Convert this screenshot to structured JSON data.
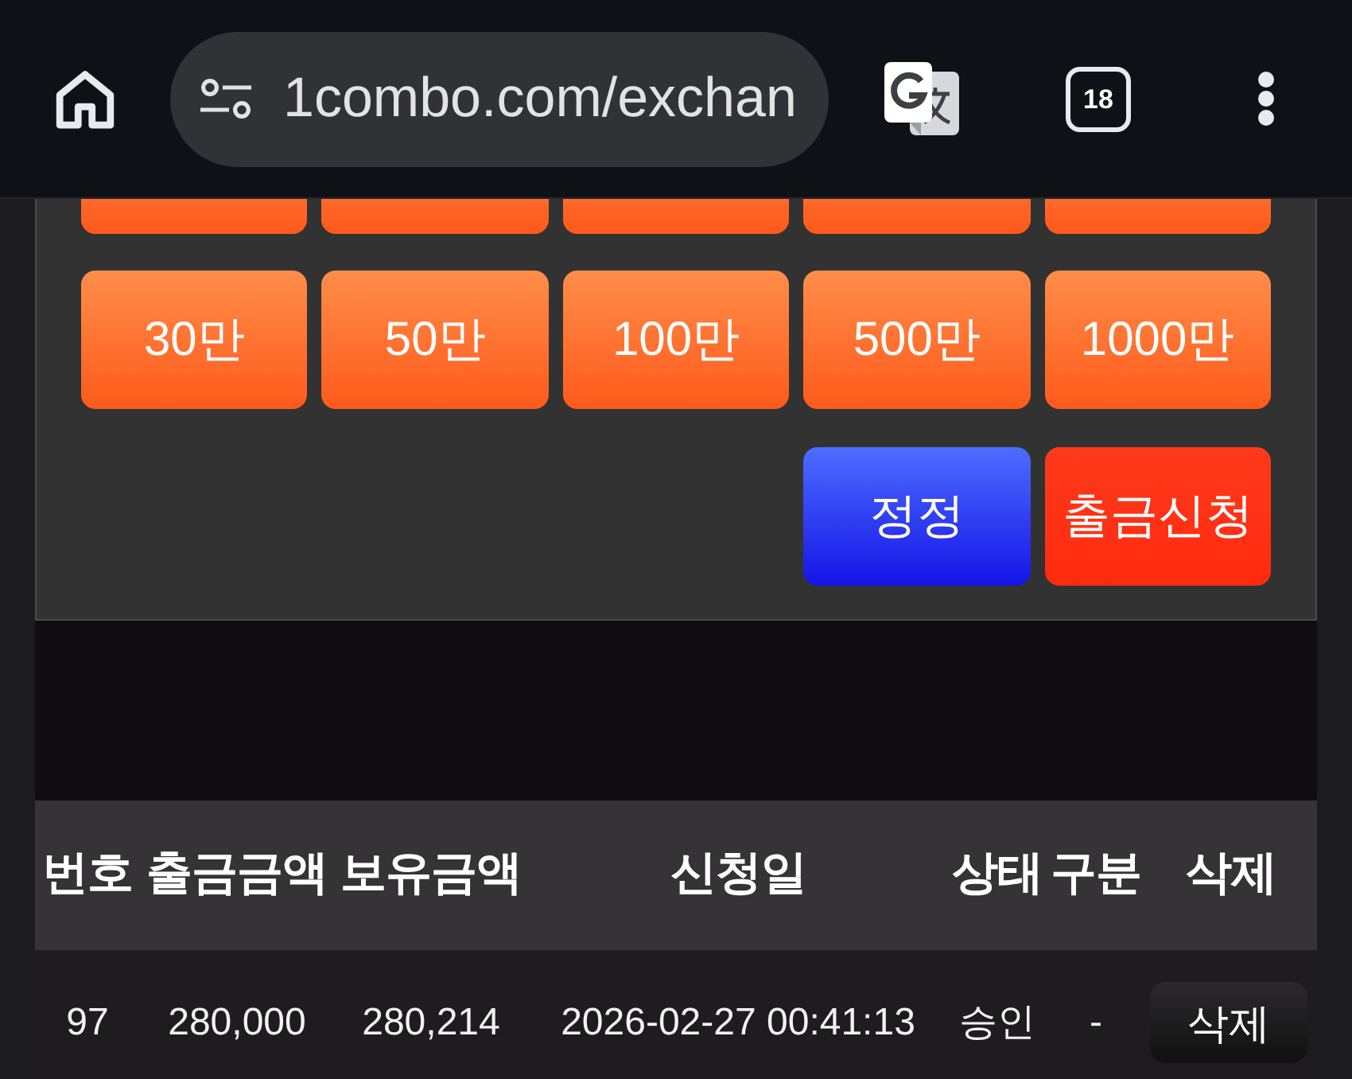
{
  "browser": {
    "url": "1combo.com/exchan",
    "tab_count": "18"
  },
  "amount_rows": [
    {
      "buttons": [
        {
          "clipped": true
        },
        {
          "clipped": true
        },
        {
          "clipped": true
        },
        {
          "clipped": true
        },
        {
          "clipped": true
        }
      ]
    },
    {
      "buttons": [
        {
          "label": "30만",
          "clipped": false
        },
        {
          "label": "50만",
          "clipped": false
        },
        {
          "label": "100만",
          "clipped": false
        },
        {
          "label": "500만",
          "clipped": false
        },
        {
          "label": "1000만",
          "clipped": false
        }
      ]
    }
  ],
  "actions": [
    {
      "kind": "correct",
      "label": "정정"
    },
    {
      "kind": "submit",
      "label": "출금신청"
    }
  ],
  "table": {
    "columns": [
      "번호",
      "출금금액",
      "보유금액",
      "신청일",
      "상태",
      "구분",
      "삭제"
    ],
    "rows": [
      {
        "cells": [
          "97",
          "280,000",
          "280,214",
          "2026-02-27 00:41:13",
          "승인",
          "-"
        ],
        "delete_label": "삭제"
      }
    ]
  }
}
